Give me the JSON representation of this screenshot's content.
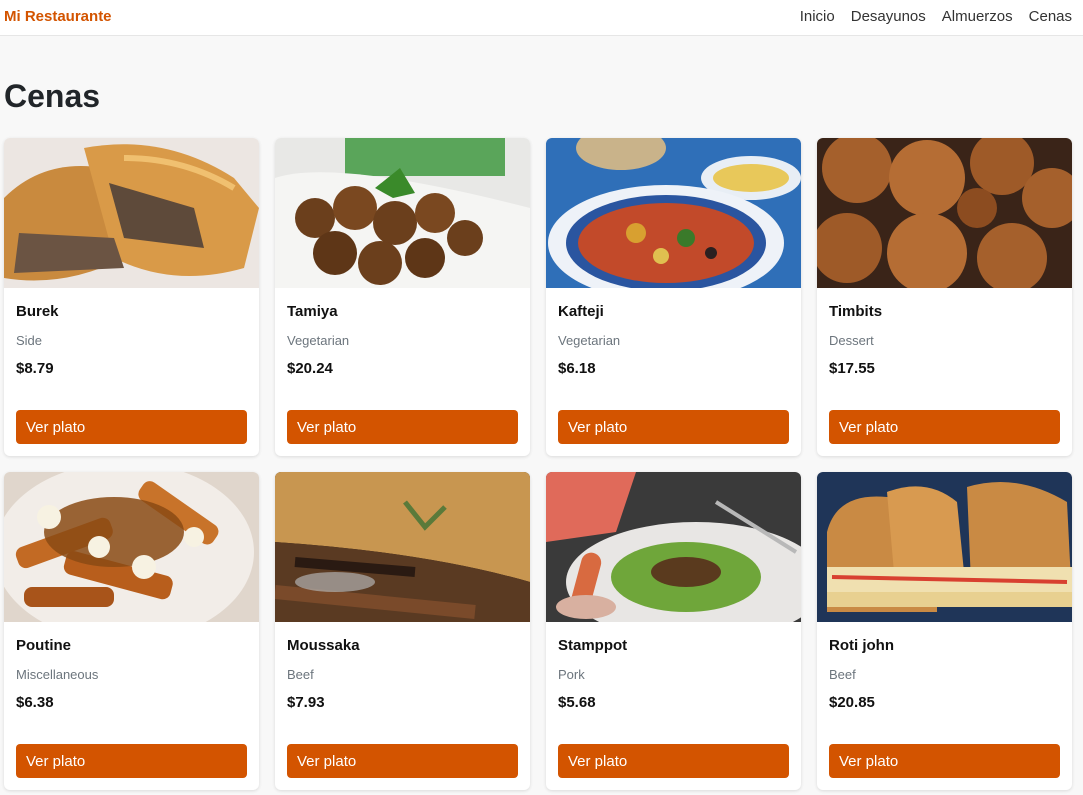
{
  "navbar": {
    "brand": "Mi Restaurante",
    "links": [
      "Inicio",
      "Desayunos",
      "Almuerzos",
      "Cenas"
    ]
  },
  "page": {
    "title": "Cenas"
  },
  "button_label": "Ver plato",
  "colors": {
    "accent": "#d35400",
    "background": "#f8f8f8"
  },
  "dishes": [
    {
      "name": "Burek",
      "category": "Side",
      "price": "$8.79"
    },
    {
      "name": "Tamiya",
      "category": "Vegetarian",
      "price": "$20.24"
    },
    {
      "name": "Kafteji",
      "category": "Vegetarian",
      "price": "$6.18"
    },
    {
      "name": "Timbits",
      "category": "Dessert",
      "price": "$17.55"
    },
    {
      "name": "Poutine",
      "category": "Miscellaneous",
      "price": "$6.38"
    },
    {
      "name": "Moussaka",
      "category": "Beef",
      "price": "$7.93"
    },
    {
      "name": "Stamppot",
      "category": "Pork",
      "price": "$5.68"
    },
    {
      "name": "Roti john",
      "category": "Beef",
      "price": "$20.85"
    }
  ]
}
